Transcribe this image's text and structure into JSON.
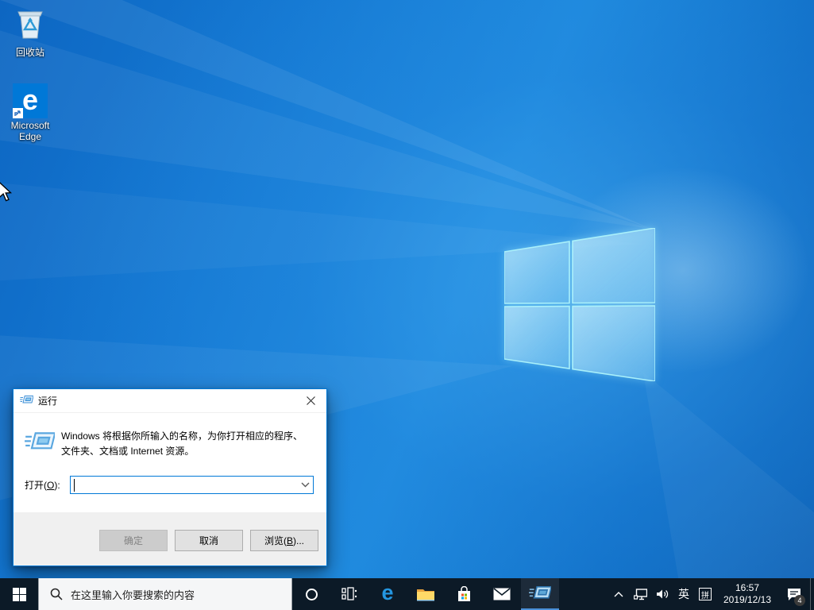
{
  "desktop": {
    "icons": [
      {
        "label": "回收站"
      },
      {
        "label": "Microsoft Edge"
      }
    ]
  },
  "run_dialog": {
    "title": "运行",
    "description": "Windows 将根据你所输入的名称，为你打开相应的程序、文件夹、文档或 Internet 资源。",
    "open_label": {
      "prefix": "打开(",
      "mnemonic": "O",
      "suffix": "):"
    },
    "input_value": "",
    "buttons": {
      "ok": "确定",
      "cancel": "取消",
      "browse": {
        "prefix": "浏览(",
        "mnemonic": "B",
        "suffix": ")..."
      }
    }
  },
  "taskbar": {
    "search": {
      "placeholder": "在这里输入你要搜索的内容"
    },
    "tray": {
      "ime_language": "英",
      "ime_mode": "拼",
      "time": "16:57",
      "date": "2019/12/13",
      "notification_count": "4"
    }
  },
  "colors": {
    "accent": "#0078d7",
    "taskbar_bg": "#0c1a27",
    "active_underline": "#4a90d9",
    "wallpaper_base": "#1478d2"
  }
}
